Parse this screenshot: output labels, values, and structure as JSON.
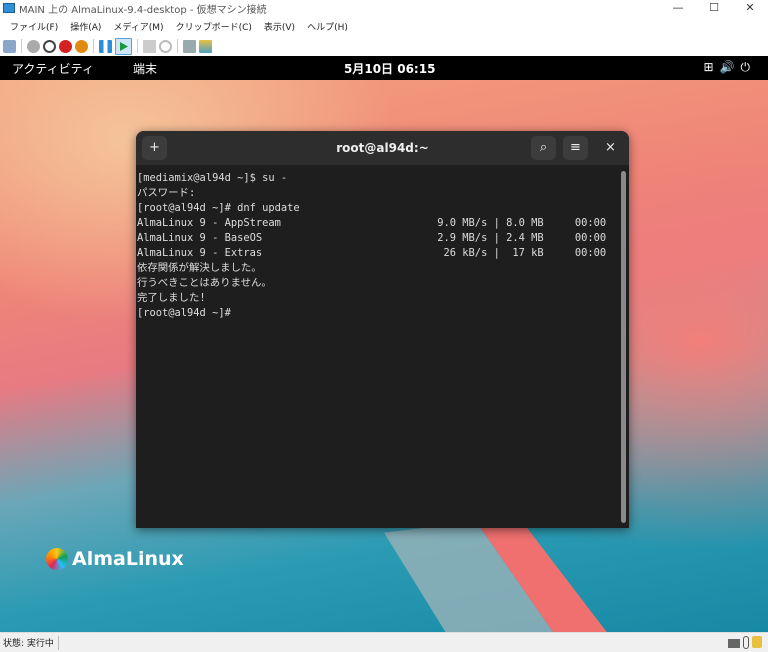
{
  "window": {
    "title": "MAIN 上の AlmaLinux-9.4-desktop  - 仮想マシン接続",
    "minimize": "—",
    "maximize": "☐",
    "close": "✕"
  },
  "menu": [
    "ファイル(F)",
    "操作(A)",
    "メディア(M)",
    "クリップボード(C)",
    "表示(V)",
    "ヘルプ(H)"
  ],
  "gnome": {
    "activities": "アクティビティ",
    "app": "端末",
    "clock": "5月10日  06:15",
    "sys_icons": "⊞🔊⏻"
  },
  "terminal": {
    "title": "root@al94d:~",
    "new_tab": "+",
    "search": "⌕",
    "menu": "≡",
    "close": "×",
    "lines": [
      "[mediamix@al94d ~]$ su -",
      "パスワード:",
      "[root@al94d ~]# dnf update",
      "AlmaLinux 9 - AppStream                         9.0 MB/s | 8.0 MB     00:00",
      "AlmaLinux 9 - BaseOS                            2.9 MB/s | 2.4 MB     00:00",
      "AlmaLinux 9 - Extras                             26 kB/s |  17 kB     00:00",
      "依存関係が解決しました。",
      "行うべきことはありません。",
      "完了しました!",
      "[root@al94d ~]#"
    ]
  },
  "desktop": {
    "logo_text": "AlmaLinux"
  },
  "status": {
    "text": "状態: 実行中"
  }
}
